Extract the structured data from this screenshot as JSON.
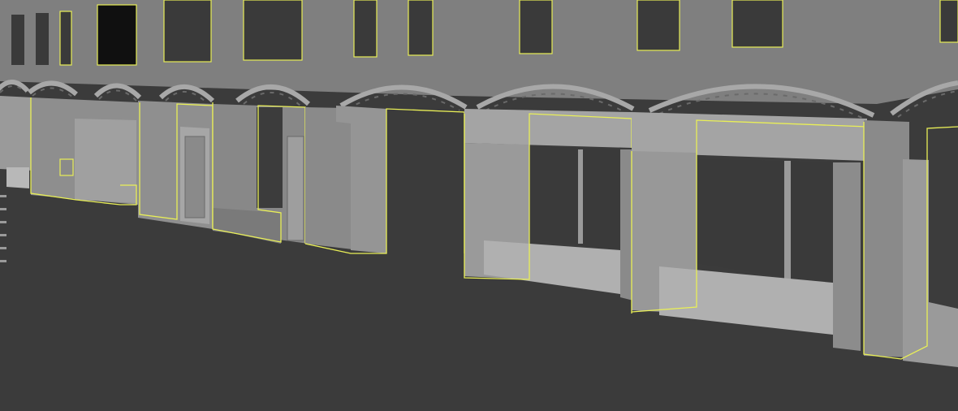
{
  "viewport": {
    "mode": "3d-perspective-shaded",
    "background_color": "#3c3c3c",
    "ground_color": "#3b3b3b",
    "facade_color": "#7d7d7d",
    "selection_color": "#e9ef57",
    "window_color": "#3a3a3a"
  },
  "scene": {
    "objects": [
      {
        "name": "upper-facade",
        "selected": false
      },
      {
        "name": "arch-cornice",
        "selected": false
      },
      {
        "name": "storefront-1",
        "selected": true
      },
      {
        "name": "storefront-2",
        "selected": true
      },
      {
        "name": "storefront-3",
        "selected": true
      },
      {
        "name": "pier-block",
        "selected": true
      },
      {
        "name": "storefront-4",
        "selected": true
      },
      {
        "name": "storefront-5",
        "selected": true
      },
      {
        "name": "storefront-6",
        "selected": true
      }
    ]
  }
}
